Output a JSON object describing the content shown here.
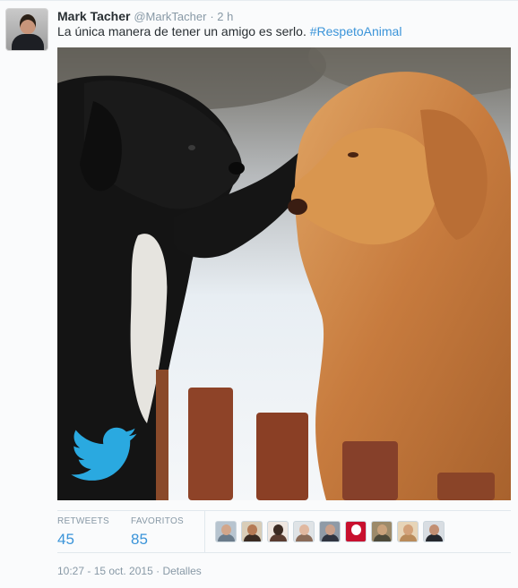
{
  "tweet": {
    "author_name": "Mark Tacher",
    "author_handle": "@MarkTacher",
    "time_ago": "· 2 h",
    "text": "La única manera de tener un amigo es serlo. ",
    "hashtag": "#RespetoAnimal"
  },
  "media": {
    "description_icon": "twitter-bird-icon",
    "bird_color": "#2aa9e0"
  },
  "stats": {
    "retweets_label": "RETWEETS",
    "retweets_value": "45",
    "favorites_label": "FAVORITOS",
    "favorites_value": "85"
  },
  "favoriters": [
    {
      "name": "favoriter-1",
      "bg": "#b7c4cf",
      "head": "#d2a68a",
      "body": "#6a7b8a"
    },
    {
      "name": "favoriter-2",
      "bg": "#d9cdb8",
      "head": "#b57a55",
      "body": "#3a2b22"
    },
    {
      "name": "favoriter-3",
      "bg": "#efe6e0",
      "head": "#3b2a22",
      "body": "#5a3c30"
    },
    {
      "name": "favoriter-4",
      "bg": "#dfe3e6",
      "head": "#e0b8a0",
      "body": "#8a6b58"
    },
    {
      "name": "favoriter-5",
      "bg": "#8f9aa6",
      "head": "#caa08a",
      "body": "#2f3440"
    },
    {
      "name": "favoriter-6",
      "bg": "#c8102e",
      "head": "#ffffff",
      "body": "#c8102e"
    },
    {
      "name": "favoriter-7",
      "bg": "#9c8a6a",
      "head": "#c9a27c",
      "body": "#4d4a3a"
    },
    {
      "name": "favoriter-8",
      "bg": "#e7d5b8",
      "head": "#d3a27a",
      "body": "#b98b5a"
    },
    {
      "name": "favoriter-9",
      "bg": "#d8dde2",
      "head": "#c28f73",
      "body": "#24272d"
    }
  ],
  "footer": {
    "timestamp": "10:27 - 15 oct. 2015",
    "separator": "·",
    "details_link": "Detalles"
  },
  "colors": {
    "link": "#3b94d9",
    "muted": "#8899a6",
    "text": "#292f33"
  }
}
